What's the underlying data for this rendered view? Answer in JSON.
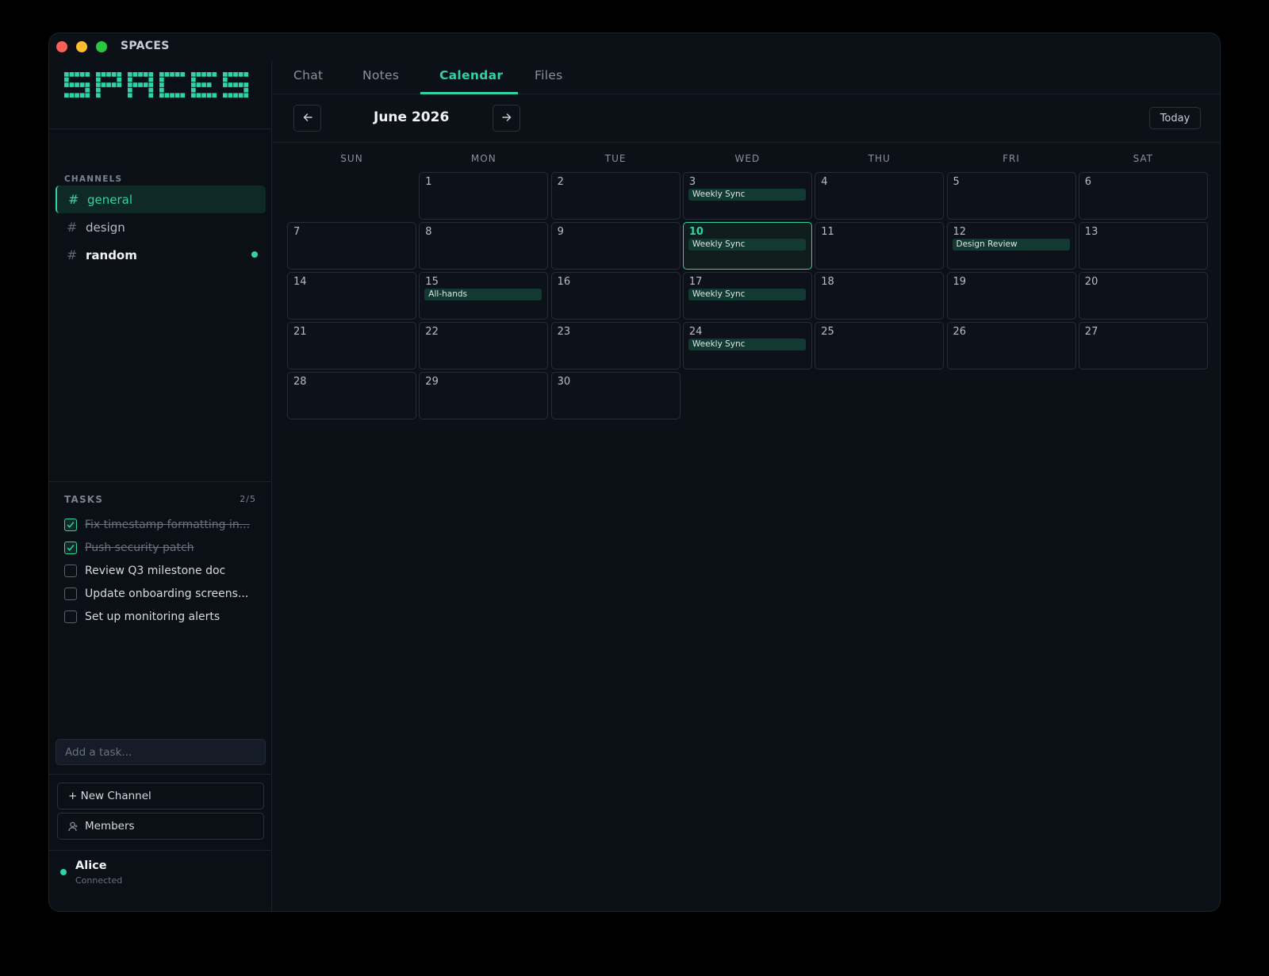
{
  "app": {
    "title": "SPACES",
    "logo_text": "SPACES",
    "accent": "#2fd3a6"
  },
  "sidebar": {
    "channels_label": "CHANNELS",
    "channels": [
      {
        "name": "general",
        "active": true,
        "unread": false
      },
      {
        "name": "design",
        "active": false,
        "unread": false
      },
      {
        "name": "random",
        "active": false,
        "unread": true
      }
    ],
    "hash": "#",
    "tasks_label": "TASKS",
    "tasks_count": "2/5",
    "tasks": [
      {
        "text": "Fix timestamp formatting in...",
        "done": true
      },
      {
        "text": "Push security patch",
        "done": true
      },
      {
        "text": "Review Q3 milestone doc",
        "done": false
      },
      {
        "text": "Update onboarding screens...",
        "done": false
      },
      {
        "text": "Set up monitoring alerts",
        "done": false
      }
    ],
    "add_task_placeholder": "Add a task...",
    "new_channel_label": "+ New Channel",
    "members_label": "Members",
    "user": {
      "name": "Alice",
      "status": "Connected"
    }
  },
  "tabs": [
    {
      "label": "Chat",
      "active": false
    },
    {
      "label": "Notes",
      "active": false
    },
    {
      "label": "Calendar",
      "active": true
    },
    {
      "label": "Files",
      "active": false
    }
  ],
  "calendar": {
    "month_title": "June 2026",
    "today_label": "Today",
    "today_day": 10,
    "weekdays": [
      "SUN",
      "MON",
      "TUE",
      "WED",
      "THU",
      "FRI",
      "SAT"
    ],
    "first_weekday_index": 1,
    "days_in_month": 30,
    "events": [
      {
        "day": 3,
        "title": "Weekly Sync"
      },
      {
        "day": 10,
        "title": "Weekly Sync"
      },
      {
        "day": 12,
        "title": "Design Review"
      },
      {
        "day": 15,
        "title": "All-hands"
      },
      {
        "day": 17,
        "title": "Weekly Sync"
      },
      {
        "day": 24,
        "title": "Weekly Sync"
      }
    ]
  }
}
